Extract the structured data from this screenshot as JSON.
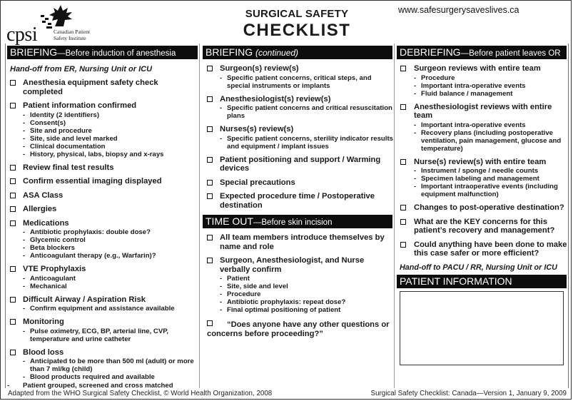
{
  "header": {
    "logo_text": "cpsi",
    "logo_sub_line1": "Canadian Patient",
    "logo_sub_line2": "Safety Institute",
    "title_line1": "SURGICAL SAFETY",
    "title_line2": "CHECKLIST",
    "url": "www.safesurgerysaveslives.ca"
  },
  "briefing": {
    "heading": "BRIEFING",
    "subheading": "—Before induction of anesthesia",
    "handoff": "Hand-off from ER, Nursing Unit or ICU",
    "items": [
      {
        "label": "Anesthesia equipment safety check completed",
        "subs": []
      },
      {
        "label": "Patient information confirmed",
        "subs": [
          "Identity (2 identifiers)",
          "Consent(s)",
          "Site and procedure",
          "Site, side and level marked",
          "Clinical documentation",
          "History, physical, labs, biopsy and x-rays"
        ]
      },
      {
        "label": "Review final test results",
        "subs": []
      },
      {
        "label": "Confirm essential imaging displayed",
        "subs": []
      },
      {
        "label": "ASA Class",
        "subs": []
      },
      {
        "label": "Allergies",
        "subs": []
      },
      {
        "label": "Medications",
        "subs": [
          "Antibiotic prophylaxis: double dose?",
          "Glycemic control",
          "Beta blockers",
          "Anticoagulant therapy (e.g., Warfarin)?"
        ]
      },
      {
        "label": "VTE Prophylaxis",
        "subs": [
          "Anticoagulant",
          "Mechanical"
        ]
      },
      {
        "label": "Difficult Airway / Aspiration Risk",
        "subs": [
          "Confirm equipment and assistance available"
        ]
      },
      {
        "label": "Monitoring",
        "subs": [
          "Pulse oximetry, ECG, BP, arterial line, CVP, temperature and urine catheter"
        ]
      },
      {
        "label": "Blood loss",
        "subs": [
          "Anticipated to be more than 500 ml (adult) or more than 7 ml/kg (child)",
          "Blood products required and available"
        ]
      }
    ],
    "trailing_sub": "Patient grouped, screened and cross matched"
  },
  "briefing_continued": {
    "heading": "BRIEFING",
    "subheading": "(continued)",
    "items": [
      {
        "label": "Surgeon(s) review(s)",
        "subs": [
          "Specific patient concerns, critical steps, and special instruments or implants"
        ]
      },
      {
        "label": "Anesthesiologist(s) review(s)",
        "subs": [
          "Specific patient concerns and critical resuscitation plans"
        ]
      },
      {
        "label": "Nurses(s) review(s)",
        "subs": [
          "Specific patient concerns, sterility indicator results and equipment / implant issues"
        ]
      },
      {
        "label": "Patient positioning and support / Warming devices",
        "subs": []
      },
      {
        "label": "Special precautions",
        "subs": []
      },
      {
        "label": "Expected procedure time / Postoperative destination",
        "subs": []
      }
    ]
  },
  "time_out": {
    "heading": "TIME OUT",
    "subheading": "—Before skin incision",
    "items": [
      {
        "label": "All team members introduce themselves by name and role",
        "subs": []
      },
      {
        "label": "Surgeon, Anesthesiologist, and Nurse verbally confirm",
        "subs": [
          "Patient",
          "Site, side and level",
          "Procedure",
          "Antibiotic prophylaxis: repeat dose?",
          "Final optimal positioning of patient"
        ]
      }
    ],
    "question": "“Does anyone have any other questions or concerns before proceeding?”"
  },
  "debriefing": {
    "heading": "DEBRIEFING",
    "subheading": "—Before patient leaves OR",
    "items": [
      {
        "label": "Surgeon reviews with entire team",
        "subs": [
          "Procedure",
          "Important intra-operative events",
          "Fluid balance / management"
        ]
      },
      {
        "label": "Anesthesiologist reviews with entire team",
        "subs": [
          "Important intra-operative events",
          "Recovery plans (including postoperative ventilation, pain management, glucose and temperature)"
        ]
      },
      {
        "label": "Nurse(s) review(s) with entire team",
        "subs": [
          "Instrument / sponge / needle counts",
          "Specimen labeling and management",
          "Important intraoperative events (including equipment malfunction)"
        ]
      },
      {
        "label": "Changes to post-operative destination?",
        "subs": []
      },
      {
        "label": "What are the KEY concerns for this patient’s recovery and management?",
        "subs": []
      },
      {
        "label": "Could anything have been done to make this case safer or more efficient?",
        "subs": []
      }
    ],
    "handoff": "Hand-off to PACU / RR, Nursing Unit or ICU"
  },
  "patient_information": {
    "heading": "PATIENT INFORMATION"
  },
  "footer": {
    "left": "Adapted from the WHO Surgical Safety Checklist, © World Health Organization, 2008",
    "right": "Surgical Safety Checklist: Canada—Version 1, January 9, 2009"
  }
}
